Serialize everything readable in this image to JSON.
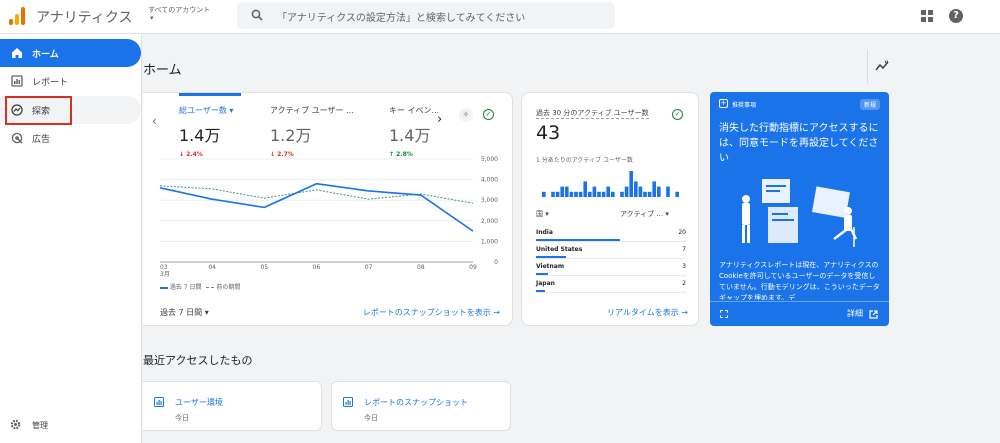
{
  "header": {
    "app_title": "アナリティクス",
    "account_label": "すべてのアカウント",
    "account_caret": "▾",
    "search_placeholder": "「アナリティクスの設定方法」と検索してみてください"
  },
  "sidebar": {
    "items": [
      {
        "label": "ホーム",
        "icon": "home-icon"
      },
      {
        "label": "レポート",
        "icon": "reports-icon"
      },
      {
        "label": "探索",
        "icon": "explore-icon"
      },
      {
        "label": "広告",
        "icon": "advertising-icon"
      }
    ],
    "admin_label": "管理"
  },
  "page": {
    "title": "ホーム"
  },
  "overview_card": {
    "metrics": [
      {
        "label": "総ユーザー数 ▾",
        "value": "1.4万",
        "delta": "↓ 2.4%"
      },
      {
        "label": "アクティブ ユーザー ...",
        "value": "1.2万",
        "delta": "↓ 2.7%"
      },
      {
        "label": "キー イベン...",
        "value": "1.4万",
        "delta": "↑ 2.8%"
      }
    ],
    "legend_current": "過去 7 日間",
    "legend_previous": "前の期間",
    "range_label": "過去 7 日間  ▾",
    "link": "レポートのスナップショットを表示 →"
  },
  "chart_data": {
    "type": "line",
    "x": [
      "03",
      "04",
      "05",
      "06",
      "07",
      "08",
      "09"
    ],
    "x_sublabel": "3月",
    "yticks": [
      "0",
      "1,000",
      "2,000",
      "3,000",
      "4,000",
      "5,000"
    ],
    "ylim": [
      0,
      5000
    ],
    "series": [
      {
        "name": "過去 7 日間",
        "values": [
          3600,
          3050,
          2650,
          3800,
          3450,
          3250,
          1500
        ]
      },
      {
        "name": "前の期間",
        "values": [
          3700,
          3550,
          3100,
          3500,
          3050,
          3300,
          2850
        ]
      }
    ],
    "colors": {
      "current": "#1a73e8",
      "previous": "#4a8c8c"
    }
  },
  "realtime_card": {
    "label": "過去 30 分のアクティブ ユーザー数",
    "value": "43",
    "sub_label": "1 分あたりのアクティブ ユーザー数",
    "minute_bars": [
      1,
      0,
      1,
      1,
      2,
      2,
      1,
      1,
      1,
      3,
      1,
      2,
      1,
      1,
      2,
      1,
      0,
      1,
      2,
      5,
      3,
      2,
      1,
      1,
      3,
      2,
      0,
      2,
      0,
      1
    ],
    "col_country": "国 ▾",
    "col_users": "アクティブ ... ▾",
    "rows": [
      {
        "country": "India",
        "users": "20",
        "share": 0.56
      },
      {
        "country": "United States",
        "users": "7",
        "share": 0.2
      },
      {
        "country": "Vietnam",
        "users": "3",
        "share": 0.08
      },
      {
        "country": "Japan",
        "users": "2",
        "share": 0.06
      }
    ],
    "link": "リアルタイムを表示 →"
  },
  "tip_card": {
    "header": "推奨事項",
    "badge": "新規",
    "title": "消失した行動指標にアクセスするには、同意モードを再設定してください",
    "body": "アナリティクスレポートは現在、アナリティクスのCookieを許可しているユーザーのデータを受信していません。行動モデリングは、こういったデータギャップを埋めます。デ",
    "details": "詳細"
  },
  "recent": {
    "title": "最近アクセスしたもの",
    "items": [
      {
        "label": "ユーザー環境",
        "sub": "今日"
      },
      {
        "label": "レポートのスナップショット",
        "sub": "今日"
      }
    ]
  },
  "colors": {
    "accent": "#1a73e8",
    "negative": "#d93025",
    "positive": "#188038",
    "highlight_box": "#d93025"
  }
}
